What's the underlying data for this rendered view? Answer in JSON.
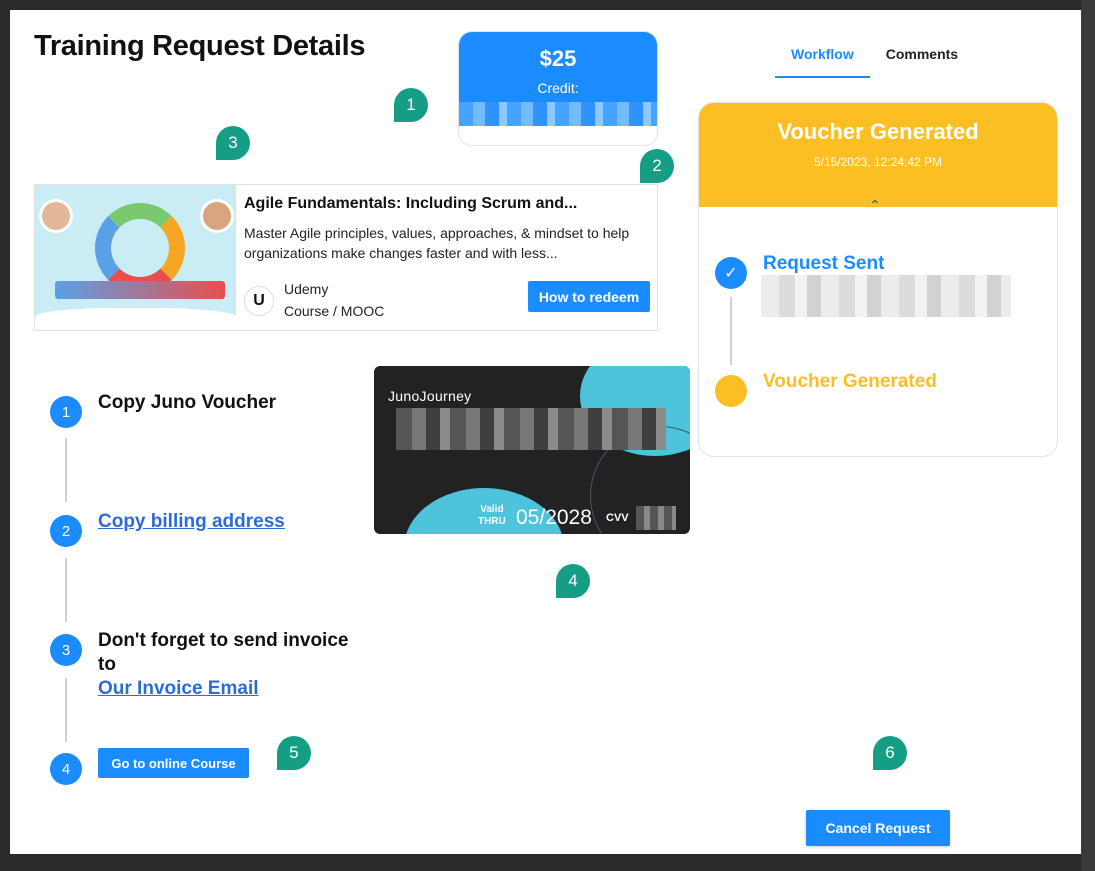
{
  "page": {
    "title": "Training Request Details"
  },
  "credit": {
    "amount": "$25",
    "label": "Credit:"
  },
  "tabs": [
    {
      "label": "Workflow",
      "active": true
    },
    {
      "label": "Comments",
      "active": false
    }
  ],
  "course": {
    "title": "Agile Fundamentals: Including Scrum and...",
    "description": "Master Agile principles, values, approaches, & mindset to help organizations make changes faster and with less...",
    "provider": "Udemy",
    "type": "Course / MOOC",
    "provider_logo": "U",
    "redeem_label": "How to redeem"
  },
  "voucher_status": {
    "title": "Voucher Generated",
    "date": "5/15/2023, 12:24:42 PM",
    "steps": [
      {
        "label": "Request Sent",
        "status": "complete"
      },
      {
        "label": "Voucher Generated",
        "status": "current"
      }
    ]
  },
  "instructions": {
    "step1_num": "1",
    "step1_label": "Copy Juno Voucher",
    "step2_num": "2",
    "step2_link": "Copy billing address",
    "step3_num": "3",
    "step3_line1": "Don't forget to send invoice",
    "step3_line2": "to",
    "step3_link": "Our Invoice Email",
    "step4_num": "4",
    "step4_button": "Go to online Course"
  },
  "voucher_card": {
    "brand": "JunoJourney",
    "valid_label_1": "Valid",
    "valid_label_2": "THRU",
    "expiry": "05/2028",
    "cvv_label": "CVV"
  },
  "actions": {
    "cancel_label": "Cancel Request"
  },
  "markers": [
    "1",
    "2",
    "3",
    "4",
    "5",
    "6"
  ],
  "colors": {
    "primary": "#1a8cff",
    "accent_yellow": "#fbbf24",
    "marker_teal": "#159e85",
    "link": "#2f6bd8"
  }
}
